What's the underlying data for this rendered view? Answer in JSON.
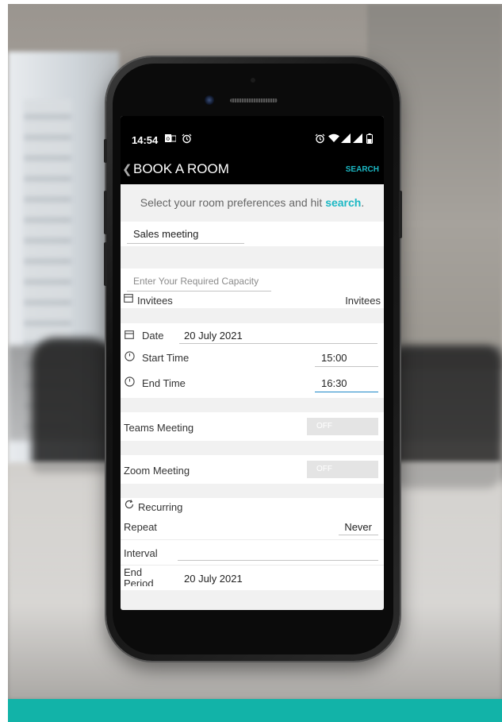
{
  "status": {
    "time": "14:54"
  },
  "appbar": {
    "title": "BOOK A ROOM",
    "search_label": "SEARCH"
  },
  "hint": {
    "text_before": "Select your room preferences and hit ",
    "text_link": "search",
    "text_after": "."
  },
  "form": {
    "meeting_title": "Sales meeting",
    "capacity_placeholder": "Enter Your Required Capacity",
    "invitees_label": "Invitees",
    "invitees_value": "Invitees",
    "date_label": "Date",
    "date_value": "20 July 2021",
    "start_label": "Start Time",
    "start_value": "15:00",
    "end_label": "End Time",
    "end_value": "16:30",
    "teams_label": "Teams Meeting",
    "teams_toggle": "OFF",
    "zoom_label": "Zoom Meeting",
    "zoom_toggle": "OFF",
    "recurring_label": "Recurring",
    "repeat_label": "Repeat",
    "repeat_value": "Never",
    "interval_label": "Interval",
    "interval_value": "",
    "end_period_label": "End Period",
    "end_period_value": "20 July 2021"
  },
  "colors": {
    "accent": "#1bb8c4",
    "brand_bar": "#12b3a8",
    "toggle_off": "#e4e4e4"
  },
  "icons": {
    "status_left": [
      "outlook-icon",
      "alarm-icon"
    ],
    "status_right": [
      "alarm-icon",
      "wifi-icon",
      "signal-icon",
      "signal-icon",
      "battery-icon"
    ],
    "invitees": "calendar-icon",
    "date": "calendar-icon",
    "start": "clock-icon",
    "end": "clock-icon",
    "recurring": "refresh-icon"
  }
}
